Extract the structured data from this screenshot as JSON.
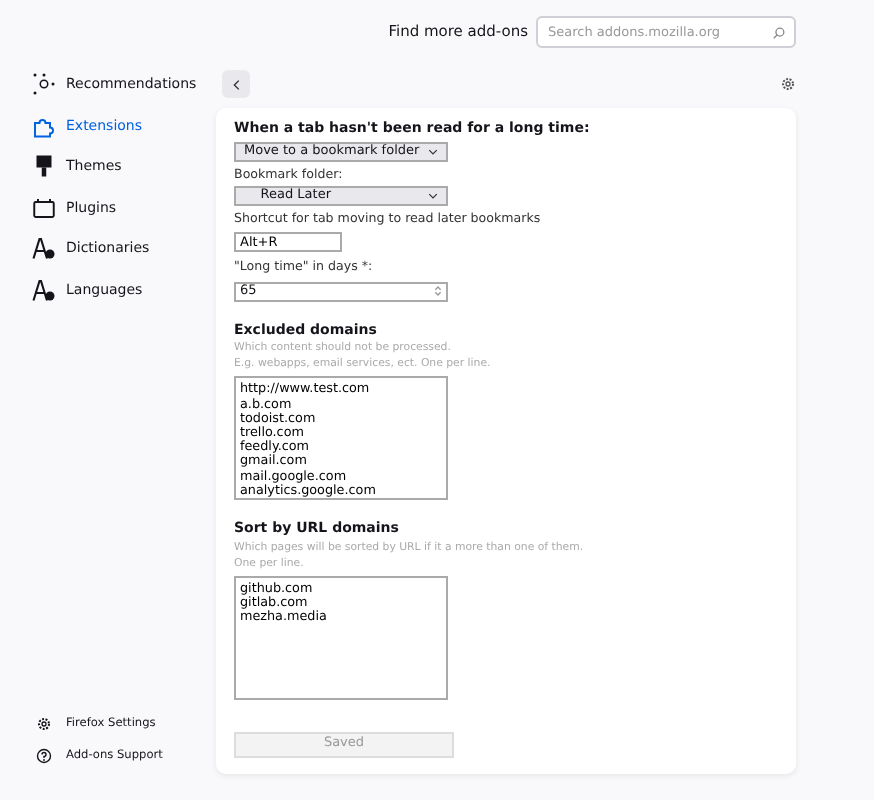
{
  "header": {
    "find_label": "Find more add-ons",
    "search_placeholder": "Search addons.mozilla.org"
  },
  "sidebar": {
    "items": [
      {
        "label": "Recommendations",
        "selected": false
      },
      {
        "label": "Extensions",
        "selected": true
      },
      {
        "label": "Themes",
        "selected": false
      },
      {
        "label": "Plugins",
        "selected": false
      },
      {
        "label": "Dictionaries",
        "selected": false
      },
      {
        "label": "Languages",
        "selected": false
      }
    ],
    "footer": [
      {
        "label": "Firefox Settings"
      },
      {
        "label": "Add-ons Support"
      }
    ]
  },
  "form": {
    "items": [
      {
        "kind": "heading",
        "text": "When a tab hasn't been read for a long time:"
      },
      {
        "kind": "select",
        "value": "Move to a bookmark folder"
      },
      {
        "kind": "label",
        "text": "Bookmark folder:"
      },
      {
        "kind": "select",
        "value": "    Read Later"
      },
      {
        "kind": "label",
        "text": "Shortcut for tab moving to read later bookmarks"
      },
      {
        "kind": "text",
        "value": "Alt+R"
      },
      {
        "kind": "label",
        "text": "\"Long time\" in days *:"
      },
      {
        "kind": "number",
        "value": "65"
      },
      {
        "kind": "heading",
        "text": "Excluded domains"
      },
      {
        "kind": "hint",
        "text": "Which content should not be processed."
      },
      {
        "kind": "hint",
        "text": "E.g. webapps, email services, ect. One per line."
      },
      {
        "kind": "textarea",
        "lines": [
          "http://www.test.com",
          "a.b.com",
          "todoist.com",
          "trello.com",
          "feedly.com",
          "gmail.com",
          "mail.google.com",
          "analytics.google.com"
        ]
      },
      {
        "kind": "heading",
        "text": "Sort by URL domains"
      },
      {
        "kind": "hint",
        "text": "Which pages will be sorted by URL if it a more than one of them."
      },
      {
        "kind": "hint",
        "text": "One per line."
      },
      {
        "kind": "textarea",
        "lines": [
          "github.com",
          "gitlab.com",
          "mezha.media"
        ]
      }
    ],
    "save_button": {
      "label": "Saved",
      "disabled": true
    }
  }
}
